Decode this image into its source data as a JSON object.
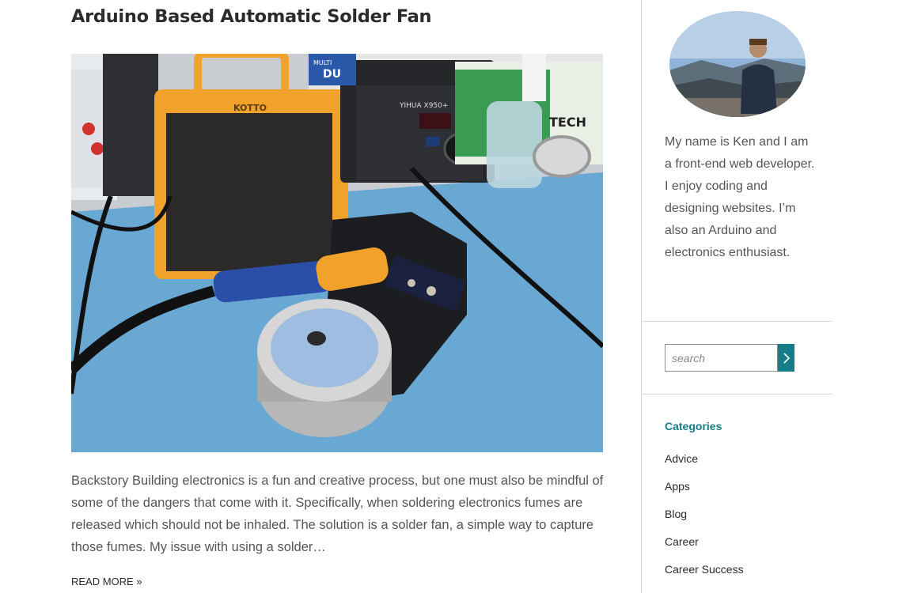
{
  "post": {
    "title": "Arduino Based Automatic Solder Fan",
    "excerpt": "Backstory Building electronics is a fun and creative process, but one must also be mindful of some of the dangers that come with it. Specifically, when soldering electronics fumes are released which should not be inhaled. The solution is a solder fan, a simple way to capture those fumes. My issue with using a solder…",
    "read_more": "READ MORE »"
  },
  "featured_image": {
    "fan_brand": "KOTTO",
    "station_brand": "YIHUA X950+",
    "box_label_1": "MULTI",
    "box_label_2": "DU",
    "box_label_3": "TECH"
  },
  "sidebar": {
    "bio": "My name is Ken and I am a front-end web developer. I enjoy coding and designing websites. I’m also an Arduino and electronics enthusiast.",
    "search": {
      "placeholder": "search"
    },
    "categories_title": "Categories",
    "categories": [
      "Advice",
      "Apps",
      "Blog",
      "Career",
      "Career Success"
    ]
  },
  "colors": {
    "accent": "#147d87",
    "text": "#555555",
    "heading": "#2b2b2b"
  }
}
